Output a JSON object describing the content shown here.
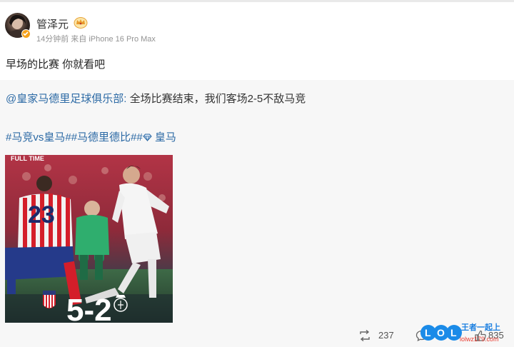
{
  "post": {
    "username": "管泽元",
    "meta": "14分钟前 来自 iPhone 16 Pro Max",
    "text": "早场的比赛 你就看吧"
  },
  "repost": {
    "mention": "@皇家马德里足球俱乐部",
    "sep": ":",
    "content": " 全场比赛结束，我们客场2-5不敌马竞",
    "hashtag_1": "#马竞vs皇马#",
    "hashtag_2": "#马德里德比#",
    "hashtag_3_end": " 皇马",
    "photo": {
      "score": "5-2"
    }
  },
  "actions": {
    "repost_count": "237",
    "like_count": "835"
  },
  "watermark": {
    "brand": "王者一起上",
    "url": "lolwz179.com"
  },
  "colors": {
    "link": "#2c6aa5",
    "repost_bg": "#f7f7f7",
    "badge": "#f7a21b"
  }
}
